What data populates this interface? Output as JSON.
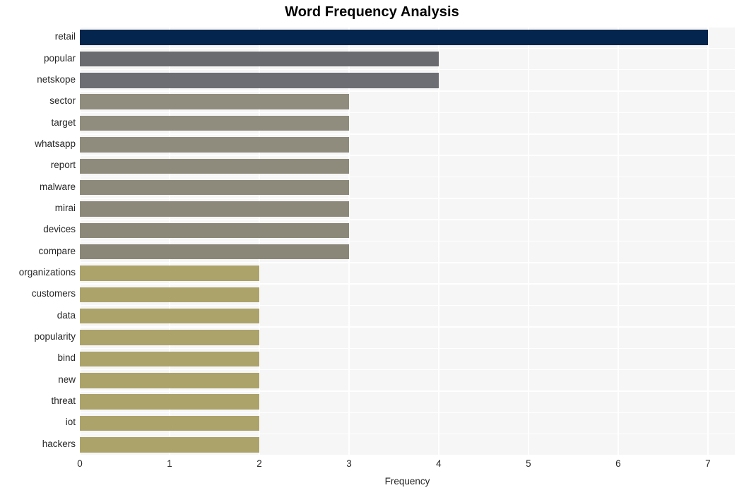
{
  "chart_data": {
    "type": "bar",
    "orientation": "horizontal",
    "title": "Word Frequency Analysis",
    "xlabel": "Frequency",
    "ylabel": "",
    "xlim": [
      0,
      7.3
    ],
    "xticks": [
      "0",
      "1",
      "2",
      "3",
      "4",
      "5",
      "6",
      "7"
    ],
    "xtick_values": [
      0,
      1,
      2,
      3,
      4,
      5,
      6,
      7
    ],
    "grid": true,
    "legend": null,
    "categories": [
      "retail",
      "popular",
      "netskope",
      "sector",
      "target",
      "whatsapp",
      "report",
      "malware",
      "mirai",
      "devices",
      "compare",
      "organizations",
      "customers",
      "data",
      "popularity",
      "bind",
      "new",
      "threat",
      "iot",
      "hackers"
    ],
    "values": [
      7,
      4,
      4,
      3,
      3,
      3,
      3,
      3,
      3,
      3,
      3,
      2,
      2,
      2,
      2,
      2,
      2,
      2,
      2,
      2
    ],
    "bar_colors": [
      "#04254d",
      "#6a6b70",
      "#6d6e73",
      "#918d7e",
      "#918d7e",
      "#908c7d",
      "#8f8b7c",
      "#8e8a7b",
      "#8d897a",
      "#8c8879",
      "#8b8778",
      "#aca36b",
      "#aca36b",
      "#aca36b",
      "#aca36b",
      "#aca36b",
      "#aca36b",
      "#aca36b",
      "#aca36b",
      "#aca36b"
    ]
  },
  "style": {
    "plot_background": "#f6f6f7",
    "grid_color": "#ffffff",
    "figure_background": "#ffffff",
    "text_color": "#262626",
    "title_color": "#000000"
  }
}
